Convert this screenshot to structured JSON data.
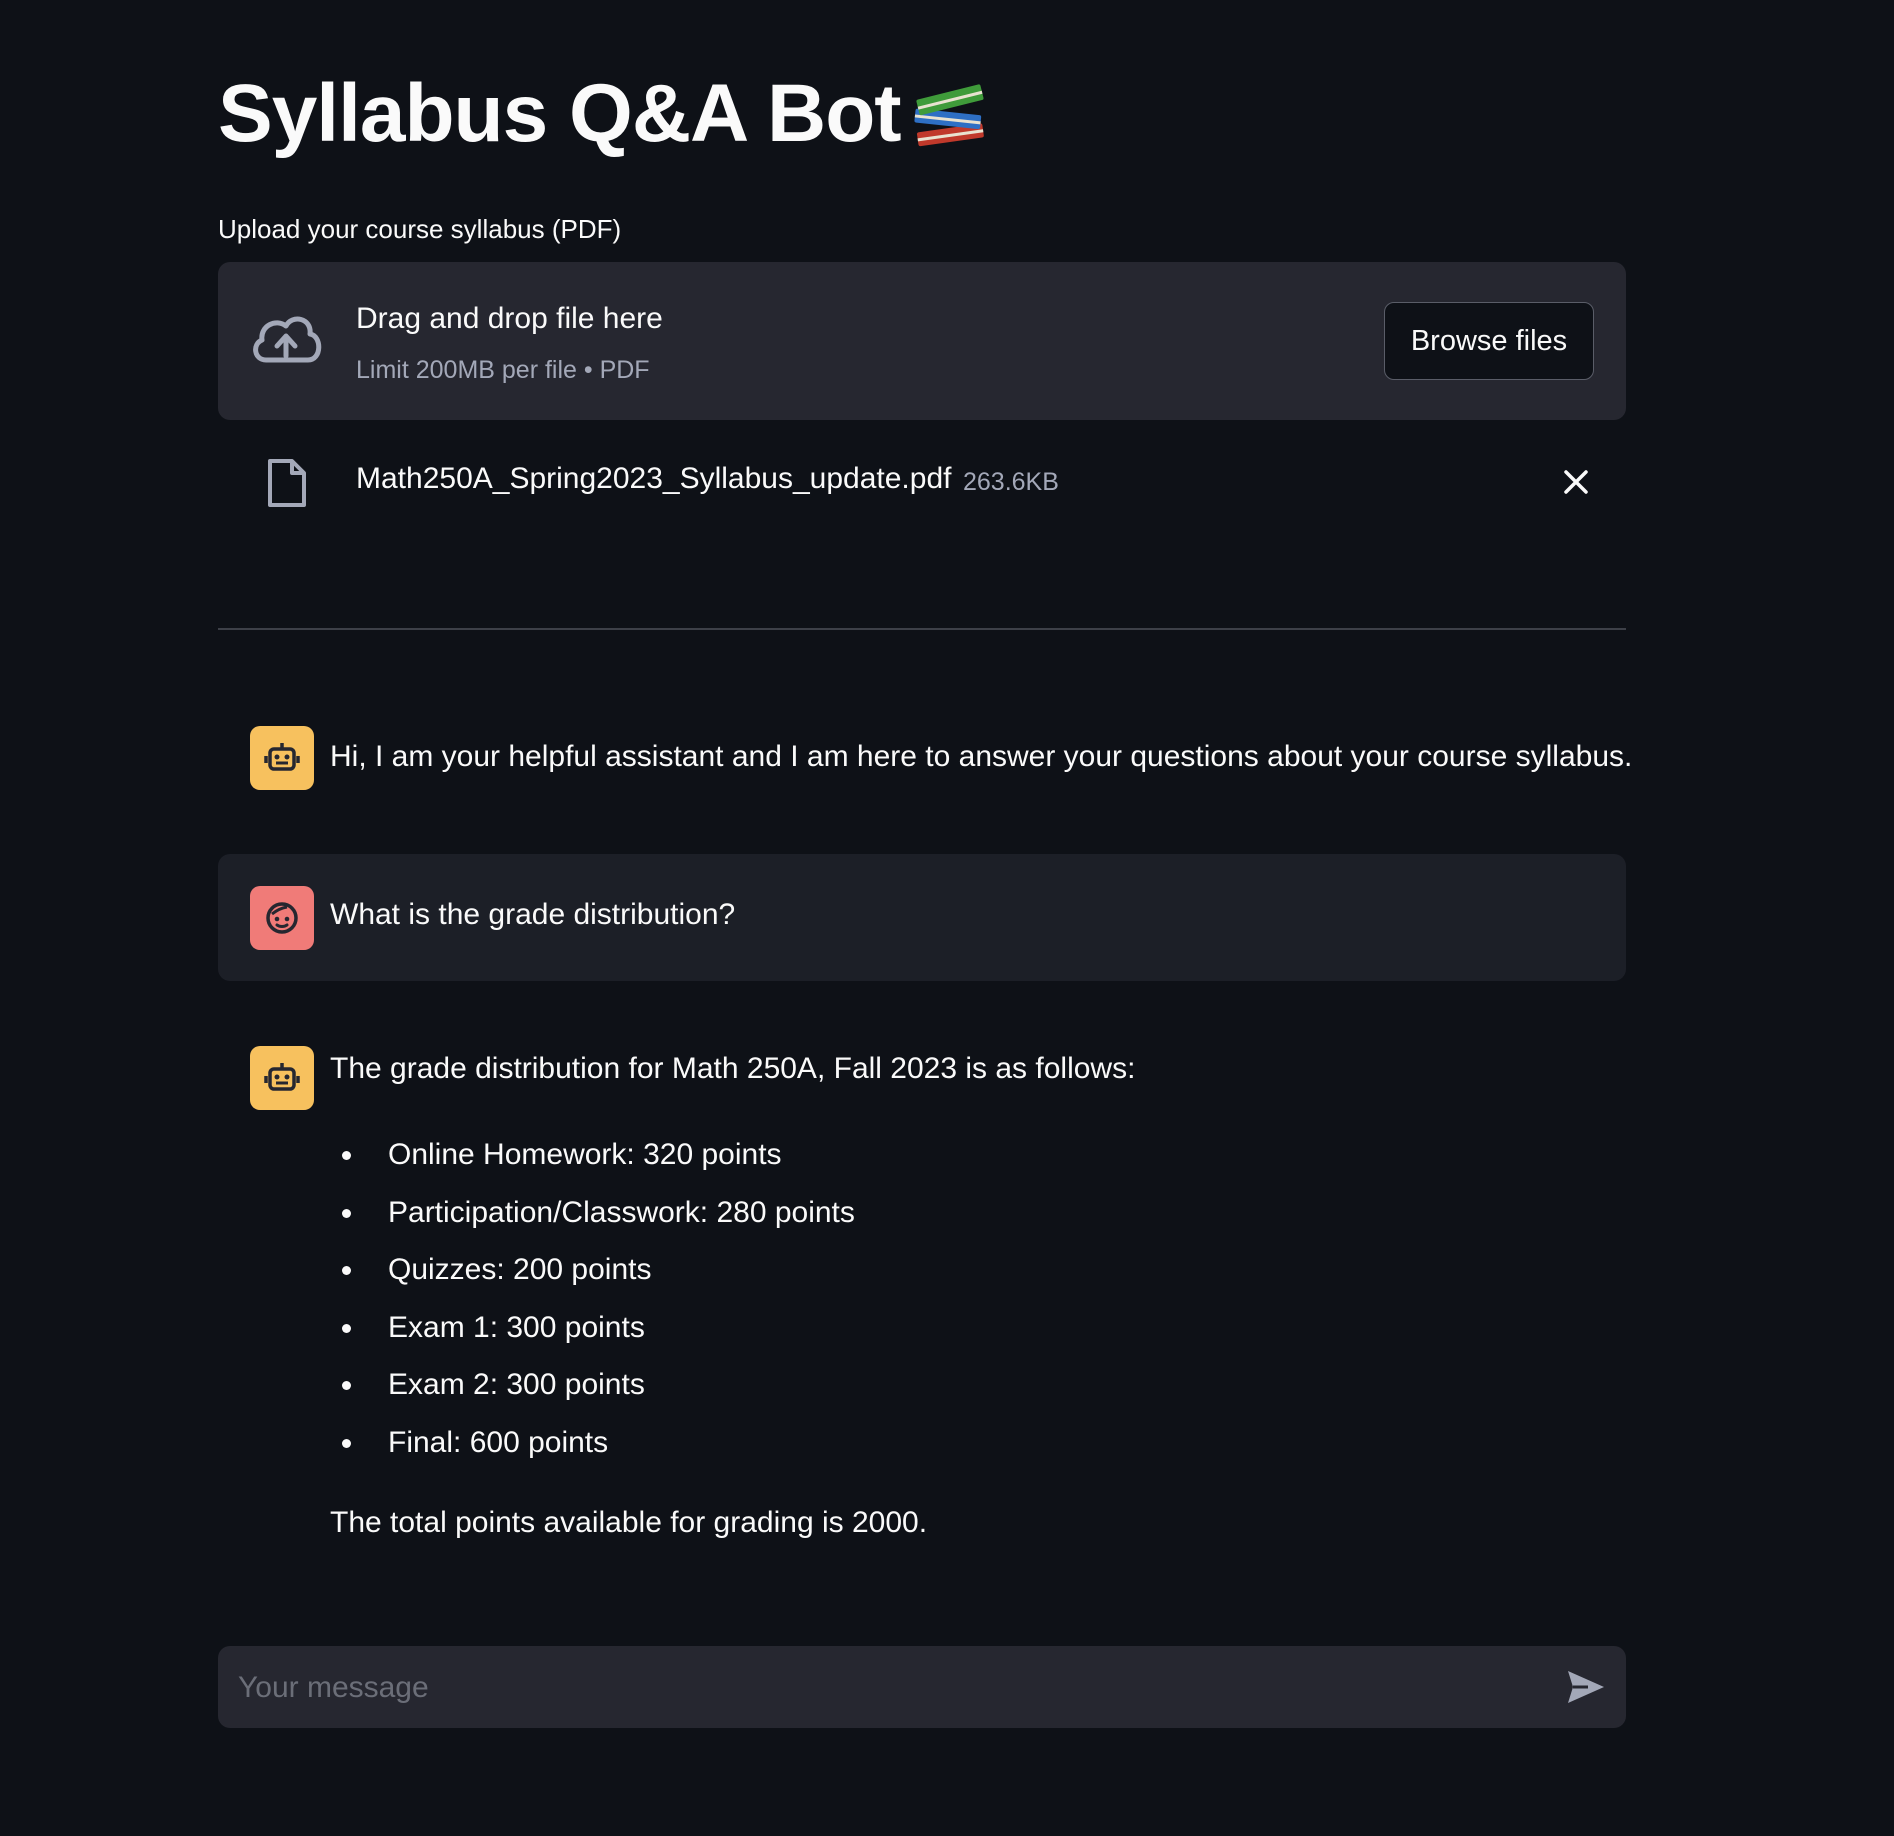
{
  "header": {
    "title": "Syllabus Q&A Bot",
    "title_icon": "books-emoji-icon"
  },
  "uploader": {
    "label": "Upload your course syllabus (PDF)",
    "drop_title": "Drag and drop file here",
    "drop_limit": "Limit 200MB per file • PDF",
    "browse_label": "Browse files",
    "file": {
      "name": "Math250A_Spring2023_Syllabus_update.pdf",
      "size": "263.6KB"
    }
  },
  "chat": {
    "messages": [
      {
        "role": "assistant",
        "text": "Hi, I am your helpful assistant and I am here to answer your questions about your course syllabus."
      },
      {
        "role": "user",
        "text": "What is the grade distribution?"
      },
      {
        "role": "assistant",
        "intro": "The grade distribution for Math 250A, Fall 2023 is as follows:",
        "items": [
          "Online Homework: 320 points",
          "Participation/Classwork: 280 points",
          "Quizzes: 200 points",
          "Exam 1: 300 points",
          "Exam 2: 300 points",
          "Final: 600 points"
        ],
        "outro": "The total points available for grading is 2000."
      }
    ],
    "input_placeholder": "Your message"
  },
  "colors": {
    "background": "#0e1117",
    "panel": "#262730",
    "bot_avatar": "#f7c15e",
    "user_avatar": "#f07b78"
  }
}
